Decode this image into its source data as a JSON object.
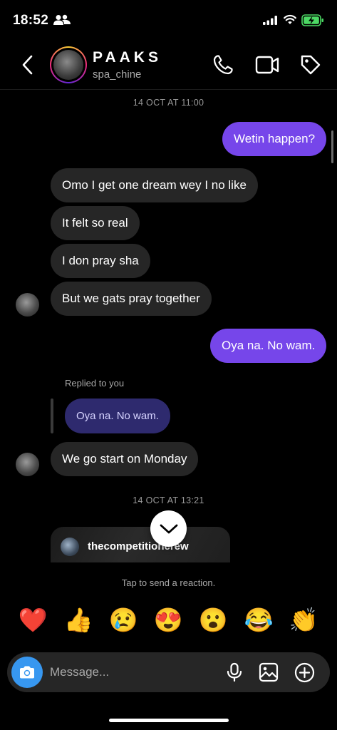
{
  "status_bar": {
    "time": "18:52",
    "icons": [
      "people-icon",
      "signal-icon",
      "wifi-icon",
      "battery-charging-icon"
    ]
  },
  "header": {
    "contact_name": "PAAKS",
    "contact_handle": "spa_chine",
    "icons": [
      "back-icon",
      "phone-icon",
      "video-icon",
      "tag-icon"
    ]
  },
  "thread": {
    "timestamps": [
      "14 OCT AT 11:00",
      "14 OCT AT 13:21"
    ],
    "messages": [
      {
        "direction": "out",
        "text": "Wetin happen?"
      },
      {
        "direction": "in",
        "text": "Omo I get one dream wey I no like"
      },
      {
        "direction": "in",
        "text": "It felt so real"
      },
      {
        "direction": "in",
        "text": "I don pray sha"
      },
      {
        "direction": "in",
        "text": "But we gats pray together"
      },
      {
        "direction": "out",
        "text": "Oya na. No wam."
      },
      {
        "direction": "in",
        "text": "We go start on Monday"
      }
    ],
    "reply": {
      "label": "Replied to you",
      "quoted_text": "Oya na. No wam."
    },
    "shared_post": {
      "username": "thecompetitioncrew"
    }
  },
  "reactions": {
    "hint": "Tap to send a reaction.",
    "emojis": [
      "❤️",
      "👍",
      "😢",
      "😍",
      "😮",
      "😂",
      "👏"
    ]
  },
  "composer": {
    "placeholder": "Message...",
    "icons": [
      "camera-icon",
      "mic-icon",
      "gallery-icon",
      "add-icon"
    ]
  },
  "colors": {
    "background": "#000000",
    "incoming_bubble": "#262626",
    "outgoing_bubble": "#7646ea",
    "reply_bubble": "#2e2a6e",
    "camera_button": "#3797f0"
  }
}
